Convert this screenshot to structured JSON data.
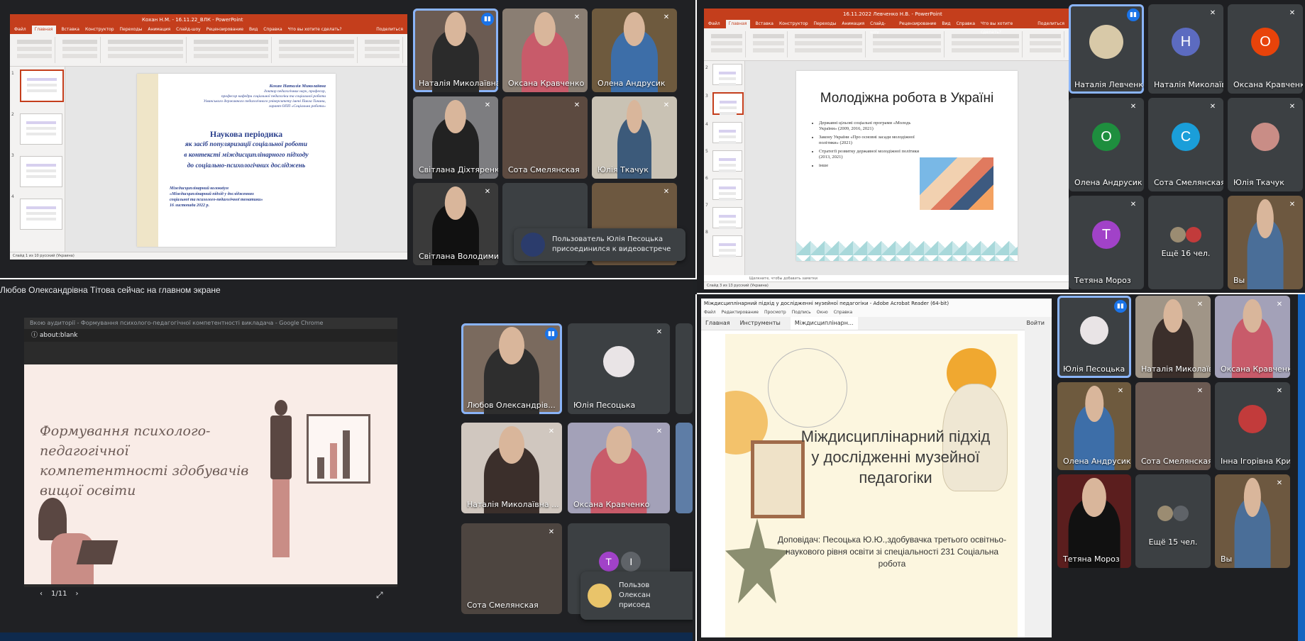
{
  "q1": {
    "window_title": "Кохан Н.М. - 16.11.22_ВЛК - PowerPoint",
    "tabs": [
      "Файл",
      "Главная",
      "Вставка",
      "Конструктор",
      "Переходы",
      "Анимация",
      "Слайд-шоу",
      "Рецензирование",
      "Вид",
      "Справка",
      "Что вы хотите сделать?"
    ],
    "share_label": "Поделиться",
    "slide": {
      "author_name": "Кохан Наталія Миколаївна",
      "author_lines": [
        "доктор педагогічних наук, професор,",
        "професор кафедри соціальної педагогіки та соціальної роботи",
        "Уманського державного педагогічного університету імені Павла Тичини,",
        "гарант ОПП «Соціальна робота»"
      ],
      "title_line1": "Наукова періодика",
      "title_line2": "як засіб популяризації соціальної роботи",
      "title_line3": "в контексті міждисциплінарного підходу",
      "title_line4": "до соціально-психологічних досліджень",
      "conf_line1": "Міждисциплінарний колоквіум",
      "conf_line2": "«Міждисциплінарний підхід у дослідженнях",
      "conf_line3": "соціальної та психолого-педагогічної тематики»",
      "conf_line4": "16 листопада 2022 р."
    },
    "status_text": "Слайд 1 из 10   русский (Украина)",
    "thumb_numbers": [
      "1",
      "2",
      "3",
      "4"
    ],
    "participants": [
      {
        "name": "Наталія Миколаївна ...",
        "speaking": true
      },
      {
        "name": "Оксана Кравченко"
      },
      {
        "name": "Олена Андрусик"
      },
      {
        "name": "Світлана Діхтяренко"
      },
      {
        "name": "Сота Смелянская"
      },
      {
        "name": "Юлія Ткачук"
      },
      {
        "name": "Світлана Володимир..."
      }
    ],
    "toast": "Пользователь Юлія Песоцька присоединился к видеовстрече"
  },
  "q2": {
    "window_title": "16.11.2022 Левченко Н.В. - PowerPoint",
    "tabs": [
      "Файл",
      "Главная",
      "Вставка",
      "Конструктор",
      "Переходы",
      "Анимация",
      "Слайд-шоу",
      "Рецензирование",
      "Вид",
      "Справка",
      "Что вы хотите сделать?"
    ],
    "share_label": "Поделиться",
    "slide": {
      "title": "Молодіжна робота в Україні",
      "bullets": [
        "Державні цільові соціальні програми «Молодь України» (2009, 2016, 2021)",
        "Закону України «Про основні засади молодіжної політики» (2021)",
        "Стратегії розвитку державної молодіжної політики (2013, 2021)",
        "інше"
      ]
    },
    "notes_hint": "Щелкните, чтобы добавить заметки",
    "status_text": "Слайд 3 из 13   русский (Украина)",
    "thumb_numbers": [
      "2",
      "3",
      "4",
      "5",
      "6",
      "7",
      "8"
    ],
    "participants": [
      {
        "name": "Наталія Левченко",
        "speaking": true
      },
      {
        "name": "Наталія Миколаївна ...",
        "initial": "Н",
        "color": "#5c6bc0"
      },
      {
        "name": "Оксана Кравченко",
        "initial": "О",
        "color": "#e8430a"
      },
      {
        "name": "Олена Андрусик",
        "initial": "О",
        "color": "#1e8e3e"
      },
      {
        "name": "Сота Смелянская",
        "initial": "С",
        "color": "#1a9ed9"
      },
      {
        "name": "Юлія Ткачук"
      },
      {
        "name": "Тетяна Мороз",
        "initial": "Т",
        "color": "#a142c8"
      },
      {
        "name": "Ещё 16 чел."
      },
      {
        "name": "Вы"
      }
    ]
  },
  "q3": {
    "header": "Любов Олександрівна Тітова сейчас на главном экране",
    "chrome_title": "Вкою аудиторії - Формування психолого-педагогічної компетентності викладача - Google Chrome",
    "url": "about:blank",
    "slide_title": "Формування психолого-педагогічної компетентності здобувачів вищої освіти",
    "page_counter": "1/11",
    "participants": [
      {
        "name": "Любов Олександрів...",
        "speaking": true
      },
      {
        "name": "Юлія Песоцька"
      },
      {
        "name": "Наталія Миколаївна ..."
      },
      {
        "name": "Оксана Кравченко"
      },
      {
        "name": "Сота Смелянская"
      }
    ],
    "extra_initials": [
      "Т",
      "І"
    ],
    "toast_lines": [
      "Пользов",
      "Олексан",
      "присоед"
    ]
  },
  "q4": {
    "window_title": "Міждисциплінарний підхід у дослідженні музейної педагогіки - Adobe Acrobat Reader (64-bit)",
    "menu": [
      "Файл",
      "Редактирование",
      "Просмотр",
      "Подпись",
      "Окно",
      "Справка"
    ],
    "tabs": [
      "Главная",
      "Инструменты",
      "Міждисциплінарн..."
    ],
    "login": "Войти",
    "title": "Міждисциплінарний підхід у дослідженні музейної педагогіки",
    "speaker": "Доповідач: Песоцька Ю.Ю.,здобувачка третього освітньо-наукового рівня освіти зі спеціальності 231 Соціальна робота",
    "participants": [
      {
        "name": "Юлія Песоцька",
        "speaking": true
      },
      {
        "name": "Наталія Миколаївна ..."
      },
      {
        "name": "Оксана Кравченко"
      },
      {
        "name": "Олена Андрусик"
      },
      {
        "name": "Сота Смелянская"
      },
      {
        "name": "Інна Ігорівна Кривор..."
      },
      {
        "name": "Тетяна Мороз"
      },
      {
        "name": "Ещё 15 чел."
      },
      {
        "name": "Вы"
      }
    ]
  },
  "icons": {
    "mute": "mic-off-icon",
    "speaking": "audio-bars-icon",
    "prev": "chevron-left-icon",
    "next": "chevron-right-icon",
    "fullscreen": "fullscreen-icon"
  },
  "colors": {
    "ppt_accent": "#c43e1c",
    "meet_tile": "#3c4043",
    "meet_speaking": "#8ab4f8",
    "meet_bg": "#202124"
  }
}
